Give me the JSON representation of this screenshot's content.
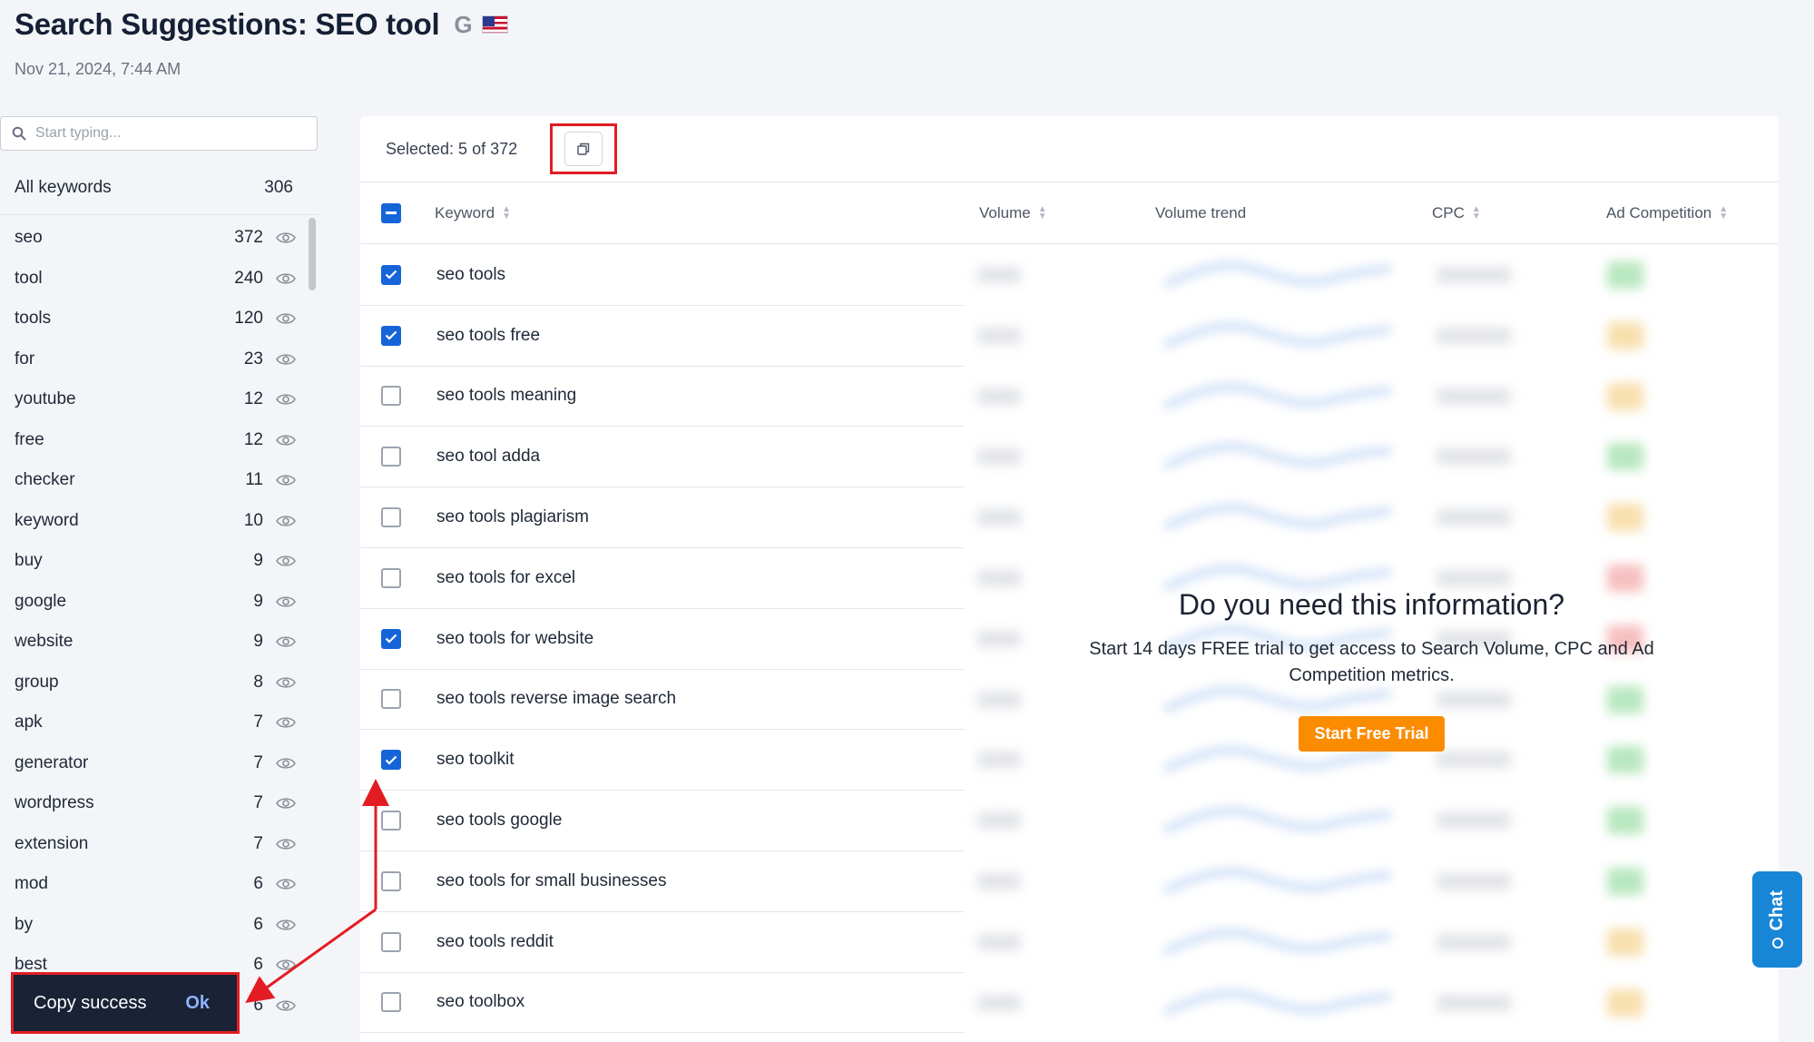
{
  "header": {
    "title": "Search Suggestions: SEO tool",
    "engine_icon": "G",
    "country_icon": "us-flag-icon",
    "date": "Nov 21, 2024, 7:44 AM"
  },
  "sidebar": {
    "search_placeholder": "Start typing...",
    "all_keywords_label": "All keywords",
    "all_keywords_count": "306",
    "items": [
      {
        "label": "seo",
        "count": "372"
      },
      {
        "label": "tool",
        "count": "240"
      },
      {
        "label": "tools",
        "count": "120"
      },
      {
        "label": "for",
        "count": "23"
      },
      {
        "label": "youtube",
        "count": "12"
      },
      {
        "label": "free",
        "count": "12"
      },
      {
        "label": "checker",
        "count": "11"
      },
      {
        "label": "keyword",
        "count": "10"
      },
      {
        "label": "buy",
        "count": "9"
      },
      {
        "label": "google",
        "count": "9"
      },
      {
        "label": "website",
        "count": "9"
      },
      {
        "label": "group",
        "count": "8"
      },
      {
        "label": "apk",
        "count": "7"
      },
      {
        "label": "generator",
        "count": "7"
      },
      {
        "label": "wordpress",
        "count": "7"
      },
      {
        "label": "extension",
        "count": "7"
      },
      {
        "label": "mod",
        "count": "6"
      },
      {
        "label": "by",
        "count": "6"
      },
      {
        "label": "best",
        "count": "6"
      },
      {
        "label": "",
        "count": "6"
      }
    ]
  },
  "toast": {
    "message": "Copy success",
    "action": "Ok"
  },
  "table": {
    "selected_text": "Selected: 5 of 372",
    "columns": {
      "keyword": "Keyword",
      "volume": "Volume",
      "trend": "Volume trend",
      "cpc": "CPC",
      "competition": "Ad Competition"
    },
    "rows": [
      {
        "keyword": "seo tools",
        "checked": true
      },
      {
        "keyword": "seo tools free",
        "checked": true
      },
      {
        "keyword": "seo tools meaning",
        "checked": false
      },
      {
        "keyword": "seo tool adda",
        "checked": false
      },
      {
        "keyword": "seo tools plagiarism",
        "checked": false
      },
      {
        "keyword": "seo tools for excel",
        "checked": false
      },
      {
        "keyword": "seo tools for website",
        "checked": true
      },
      {
        "keyword": "seo tools reverse image search",
        "checked": false
      },
      {
        "keyword": "seo toolkit",
        "checked": true
      },
      {
        "keyword": "seo tools google",
        "checked": false
      },
      {
        "keyword": "seo tools for small businesses",
        "checked": false
      },
      {
        "keyword": "seo tools reddit",
        "checked": false
      },
      {
        "keyword": "seo toolbox",
        "checked": false
      }
    ]
  },
  "overlay": {
    "title": "Do you need this information?",
    "subtitle": "Start 14 days FREE trial to get access to Search Volume, CPC and Ad Competition metrics.",
    "button": "Start Free Trial"
  },
  "chat": {
    "label": "Chat"
  },
  "colors": {
    "accent": "#1565d8",
    "cta": "#fb8c00",
    "highlight": "#e31c23",
    "toast_bg": "#1a2236",
    "chat": "#1886d6",
    "competition": [
      "#7ed48a",
      "#f2c66b",
      "#f2c66b",
      "#7ed48a",
      "#f2c66b",
      "#f08a8a",
      "#f08a8a",
      "#7ed48a",
      "#7ed48a",
      "#7ed48a",
      "#7ed48a",
      "#f2c66b",
      "#f2c66b"
    ]
  }
}
